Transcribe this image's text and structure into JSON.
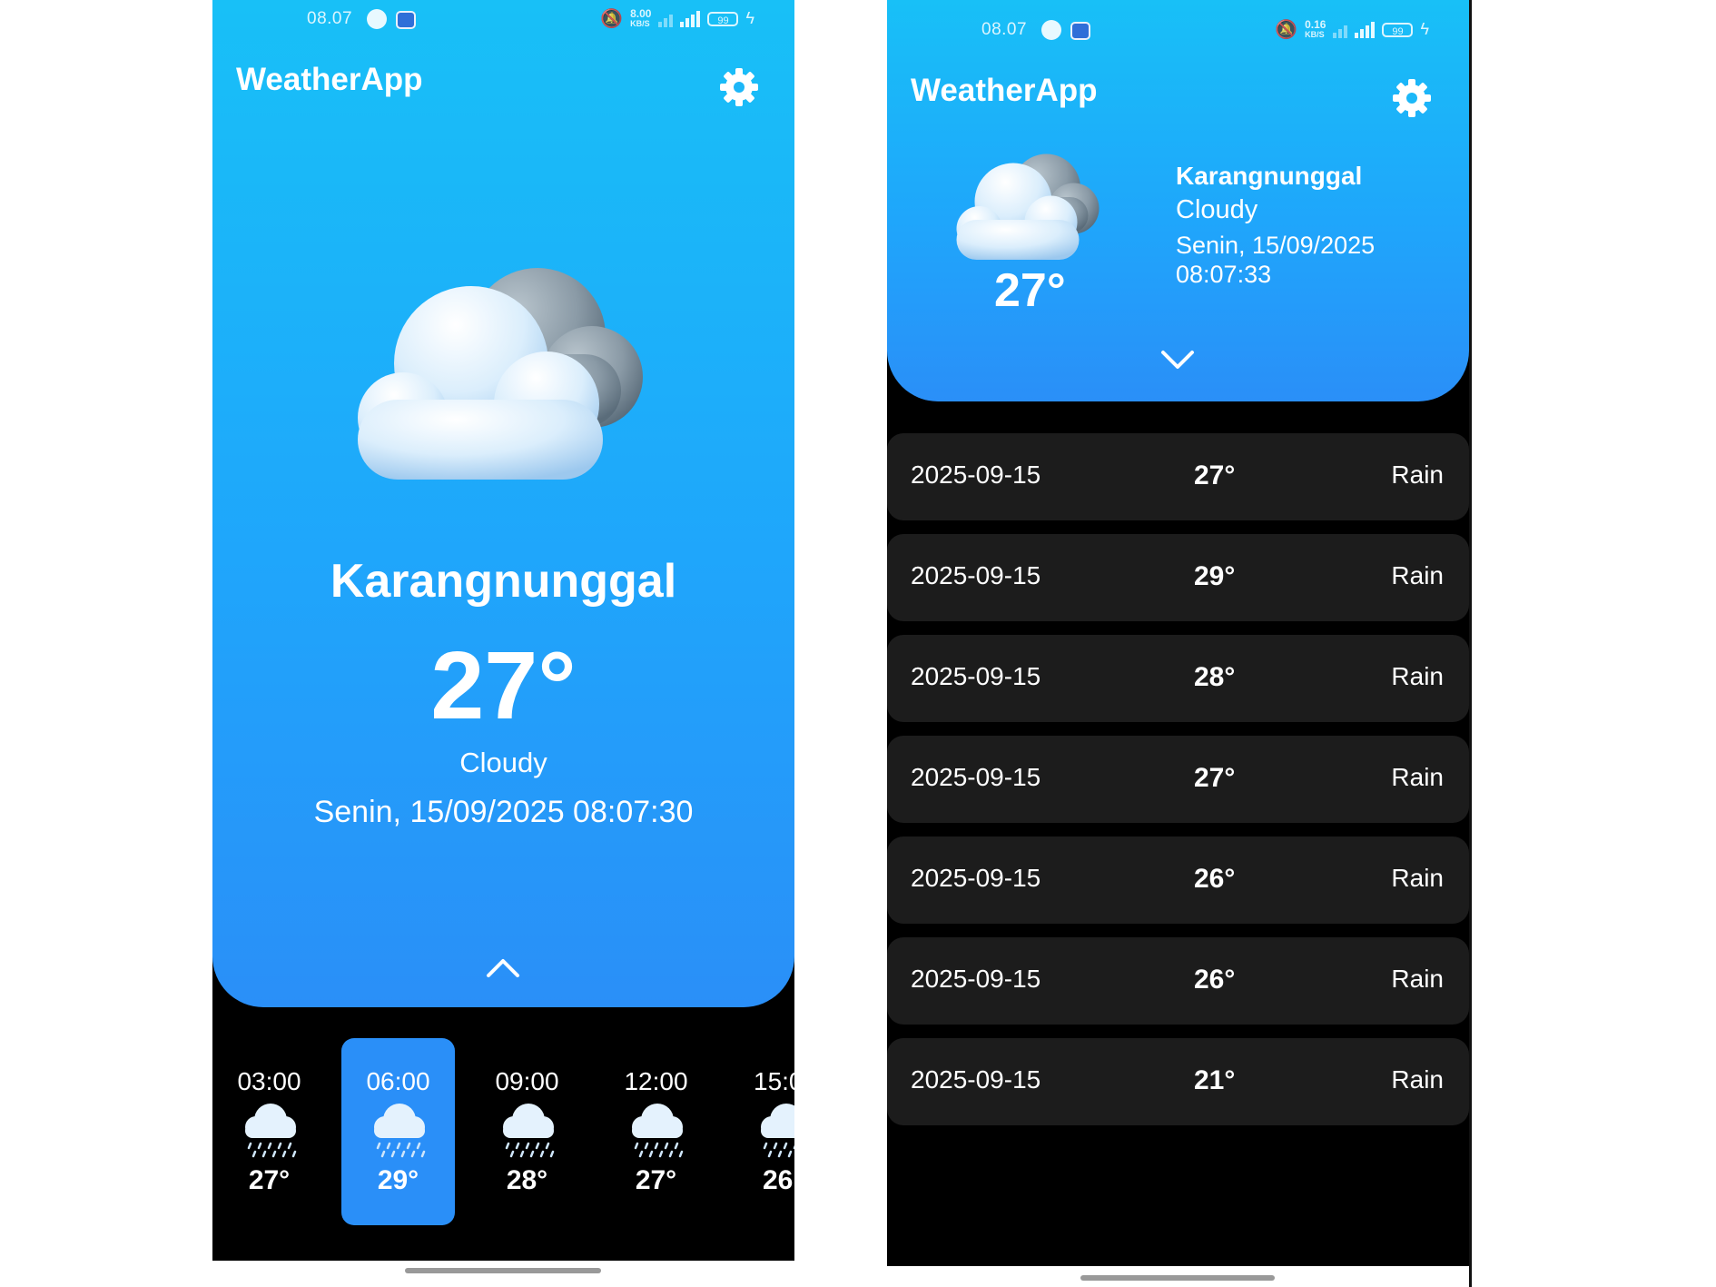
{
  "left": {
    "status": {
      "time": "08.07",
      "speed_value": "8.00",
      "speed_unit": "KB/S",
      "battery": "99"
    },
    "app_title": "WeatherApp",
    "city": "Karangnunggal",
    "temperature": "27°",
    "condition": "Cloudy",
    "datetime": "Senin, 15/09/2025 08:07:30",
    "hourly": [
      {
        "time": "03:00",
        "temp": "27°",
        "selected": false
      },
      {
        "time": "06:00",
        "temp": "29°",
        "selected": true
      },
      {
        "time": "09:00",
        "temp": "28°",
        "selected": false
      },
      {
        "time": "12:00",
        "temp": "27°",
        "selected": false
      },
      {
        "time": "15:0",
        "temp": "26",
        "selected": false
      }
    ]
  },
  "right": {
    "status": {
      "time": "08.07",
      "speed_value": "0.16",
      "speed_unit": "KB/S",
      "battery": "99"
    },
    "app_title": "WeatherApp",
    "city": "Karangnunggal",
    "condition": "Cloudy",
    "date": "Senin, 15/09/2025",
    "time": "08:07:33",
    "temperature": "27°",
    "forecast": [
      {
        "date": "2025-09-15",
        "temp": "27°",
        "condition": "Rain"
      },
      {
        "date": "2025-09-15",
        "temp": "29°",
        "condition": "Rain"
      },
      {
        "date": "2025-09-15",
        "temp": "28°",
        "condition": "Rain"
      },
      {
        "date": "2025-09-15",
        "temp": "27°",
        "condition": "Rain"
      },
      {
        "date": "2025-09-15",
        "temp": "26°",
        "condition": "Rain"
      },
      {
        "date": "2025-09-15",
        "temp": "26°",
        "condition": "Rain"
      },
      {
        "date": "2025-09-15",
        "temp": "21°",
        "condition": "Rain"
      }
    ]
  },
  "colors": {
    "hero_top": "#18c0f7",
    "hero_bottom": "#2a8ff8",
    "row_bg": "#1c1c1c",
    "selected_card": "#2a8ff8"
  },
  "icons": [
    "gear-icon",
    "cloudy-icon",
    "rain-icon",
    "chevron-up-icon",
    "chevron-down-icon",
    "mute-icon",
    "signal-icon",
    "battery-icon"
  ]
}
